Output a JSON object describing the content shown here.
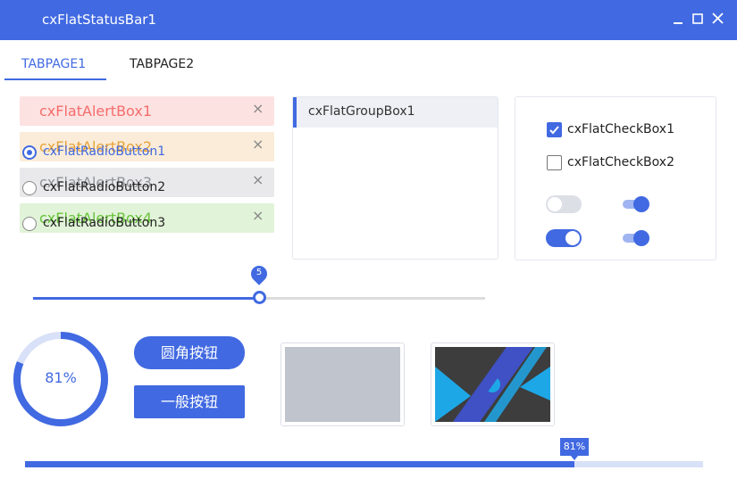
{
  "window": {
    "title": "cxFlatStatusBar1"
  },
  "tabs": [
    {
      "label": "TABPAGE1",
      "active": true
    },
    {
      "label": "TABPAGE2",
      "active": false
    }
  ],
  "alerts": [
    {
      "text": "cxFlatAlertBox1",
      "type": "danger",
      "close": "×"
    },
    {
      "text": "cxFlatAlertBox2",
      "type": "warning",
      "close": "×"
    },
    {
      "text": "cxFlatAlertBox3",
      "type": "info",
      "close": "×"
    },
    {
      "text": "cxFlatAlertBox4",
      "type": "success",
      "close": "×"
    }
  ],
  "groupbox": {
    "title": "cxFlatGroupBox1",
    "radios": [
      {
        "label": "cxFlatRadioButton1",
        "checked": true
      },
      {
        "label": "cxFlatRadioButton2",
        "checked": false
      },
      {
        "label": "cxFlatRadioButton3",
        "checked": false
      }
    ]
  },
  "checkboxes": [
    {
      "label": "cxFlatCheckBox1",
      "checked": true
    },
    {
      "label": "cxFlatCheckBox2",
      "checked": false
    }
  ],
  "toggles": [
    {
      "style": "pill",
      "on": false
    },
    {
      "style": "material",
      "on": true
    },
    {
      "style": "pill",
      "on": true
    },
    {
      "style": "material",
      "on": true
    }
  ],
  "slider": {
    "value": 5,
    "value_label": "5",
    "min": 0,
    "max": 10
  },
  "ring": {
    "value": 0.81,
    "label": "81%"
  },
  "buttons": {
    "round_label": "圆角按钮",
    "normal_label": "一般按钮"
  },
  "progress": {
    "value": 0.81,
    "label": "81%"
  },
  "colors": {
    "accent": "#4169e1",
    "accent_light": "#d8e1f7",
    "danger": "#f56c6c",
    "warning": "#e6a23c",
    "info": "#909399",
    "success": "#67c23a"
  }
}
